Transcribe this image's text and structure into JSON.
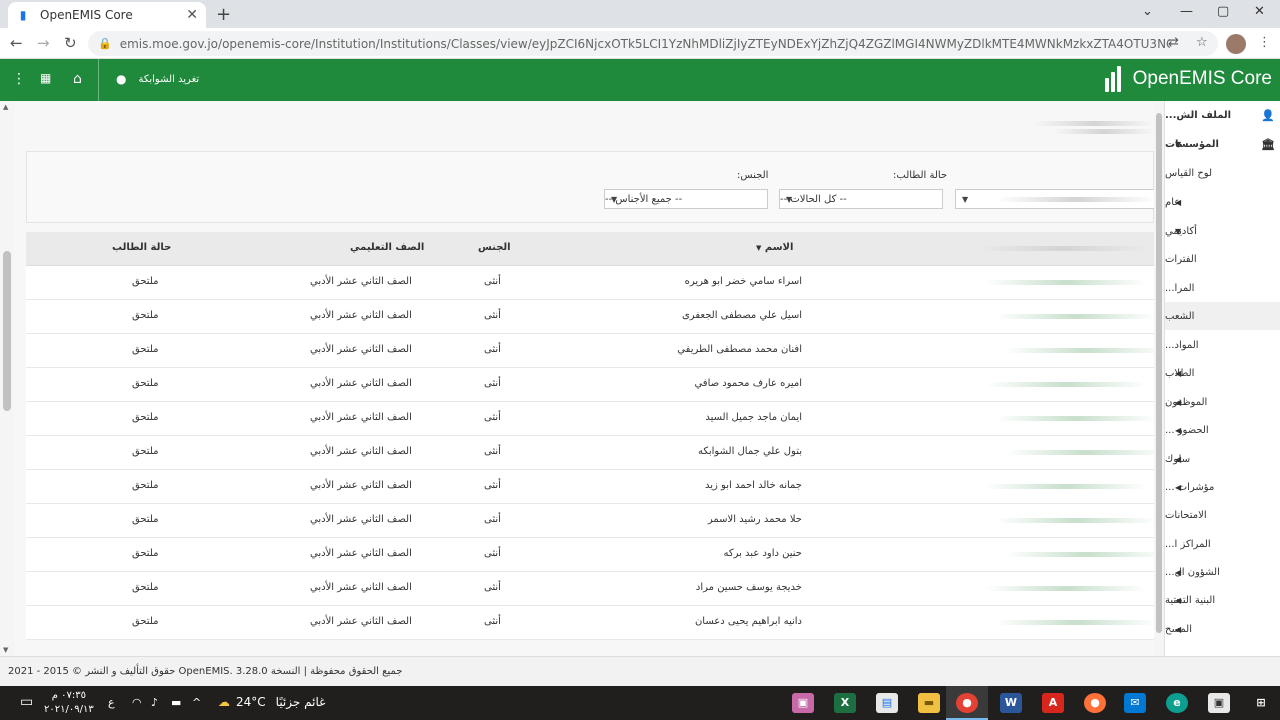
{
  "browser": {
    "tab_title": "OpenEMIS Core",
    "url_host": "emis.moe.gov.jo",
    "url_path": "/openemis-core/Institution/Institutions/Classes/view/eyJpZCI6NjcxOTk5LCI1YzNhMDliZjIyZTEyNDExYjZhZjQ4ZGZlMGI4NWMyZDlkMTE4MWNkMzkxZTA4OTU3NGM4Y2YzY2ExZTVlNGF..."
  },
  "header": {
    "user_name": "تغريد الشوابكة",
    "brand": "OpenEMIS Core"
  },
  "sidebar": {
    "items": [
      {
        "label": "الملف الش...",
        "arrow": false,
        "icon": "user-icon"
      },
      {
        "label": "المؤسسات",
        "arrow": true,
        "icon": "institution-icon"
      },
      {
        "label": "لوح القياس",
        "arrow": false
      },
      {
        "label": "عام",
        "arrow": true
      },
      {
        "label": "أكاديمي",
        "arrow": true
      },
      {
        "label": "الفترات",
        "arrow": false
      },
      {
        "label": "المرا...",
        "arrow": false
      },
      {
        "label": "الشعب",
        "arrow": false
      },
      {
        "label": "المواد...",
        "arrow": false
      },
      {
        "label": "الطلاب",
        "arrow": true
      },
      {
        "label": "الموظفون",
        "arrow": true
      },
      {
        "label": "الحضور ...",
        "arrow": true
      },
      {
        "label": "سلوك",
        "arrow": true
      },
      {
        "label": "مؤشرات ...",
        "arrow": true
      },
      {
        "label": "الامتحانات",
        "arrow": false
      },
      {
        "label": "المراكز ا...",
        "arrow": false
      },
      {
        "label": "الشؤون ال...",
        "arrow": true
      },
      {
        "label": "البنية التحتية",
        "arrow": true
      },
      {
        "label": "المسح",
        "arrow": true
      }
    ]
  },
  "filters": {
    "status_label": "حالة الطالب:",
    "status_value": "-- كل الحالات --",
    "gender_label": "الجنس:",
    "gender_value": "-- جميع الأجناس --"
  },
  "table": {
    "headers": {
      "name": "الاسم",
      "gender": "الجنس",
      "grade": "الصف التعليمي",
      "status": "حالة الطالب"
    },
    "rows": [
      {
        "name": "اسراء سامي خضر ابو هريره",
        "gender": "أنثى",
        "grade": "الصف الثاني عشر الأدبي",
        "status": "ملتحق"
      },
      {
        "name": "اسيل علي مصطفى الجعفرى",
        "gender": "أنثى",
        "grade": "الصف الثاني عشر الأدبي",
        "status": "ملتحق"
      },
      {
        "name": "افنان محمد مصطفى الطريفي",
        "gender": "أنثى",
        "grade": "الصف الثاني عشر الأدبي",
        "status": "ملتحق"
      },
      {
        "name": "اميره عارف محمود صافي",
        "gender": "أنثى",
        "grade": "الصف الثاني عشر الأدبي",
        "status": "ملتحق"
      },
      {
        "name": "ايمان ماجد جميل السيد",
        "gender": "أنثى",
        "grade": "الصف الثاني عشر الأدبي",
        "status": "ملتحق"
      },
      {
        "name": "بتول علي جمال الشوابكه",
        "gender": "أنثى",
        "grade": "الصف الثاني عشر الأدبي",
        "status": "ملتحق"
      },
      {
        "name": "جمانه خالد احمد ابو زيد",
        "gender": "أنثى",
        "grade": "الصف الثاني عشر الأدبي",
        "status": "ملتحق"
      },
      {
        "name": "حلا محمد رشيد الاسمر",
        "gender": "أنثى",
        "grade": "الصف الثاني عشر الأدبي",
        "status": "ملتحق"
      },
      {
        "name": "حنين داود عبد بركه",
        "gender": "أنثى",
        "grade": "الصف الثاني عشر الأدبي",
        "status": "ملتحق"
      },
      {
        "name": "خديجة يوسف حسين مراد",
        "gender": "أنثى",
        "grade": "الصف الثاني عشر الأدبي",
        "status": "ملتحق"
      },
      {
        "name": "دانيه ابراهيم يحيى دعسان",
        "gender": "أنثى",
        "grade": "الصف الثاني عشر الأدبي",
        "status": "ملتحق"
      }
    ]
  },
  "footer": {
    "text": "حقوق التأليف و النشر © 2015 - 2021 OpenEMIS. جميع الحقوق محفوظة | النسخة 3.28.0"
  },
  "taskbar": {
    "time": "٠٧:٣٥ م",
    "date": "٢٠٢١/٠٩/١٣",
    "lang": "ع",
    "temperature": "24°C",
    "weather": "غائم جزئيًا"
  },
  "colors": {
    "header_green": "#1f8a3c",
    "taskbar": "#201f1e"
  }
}
